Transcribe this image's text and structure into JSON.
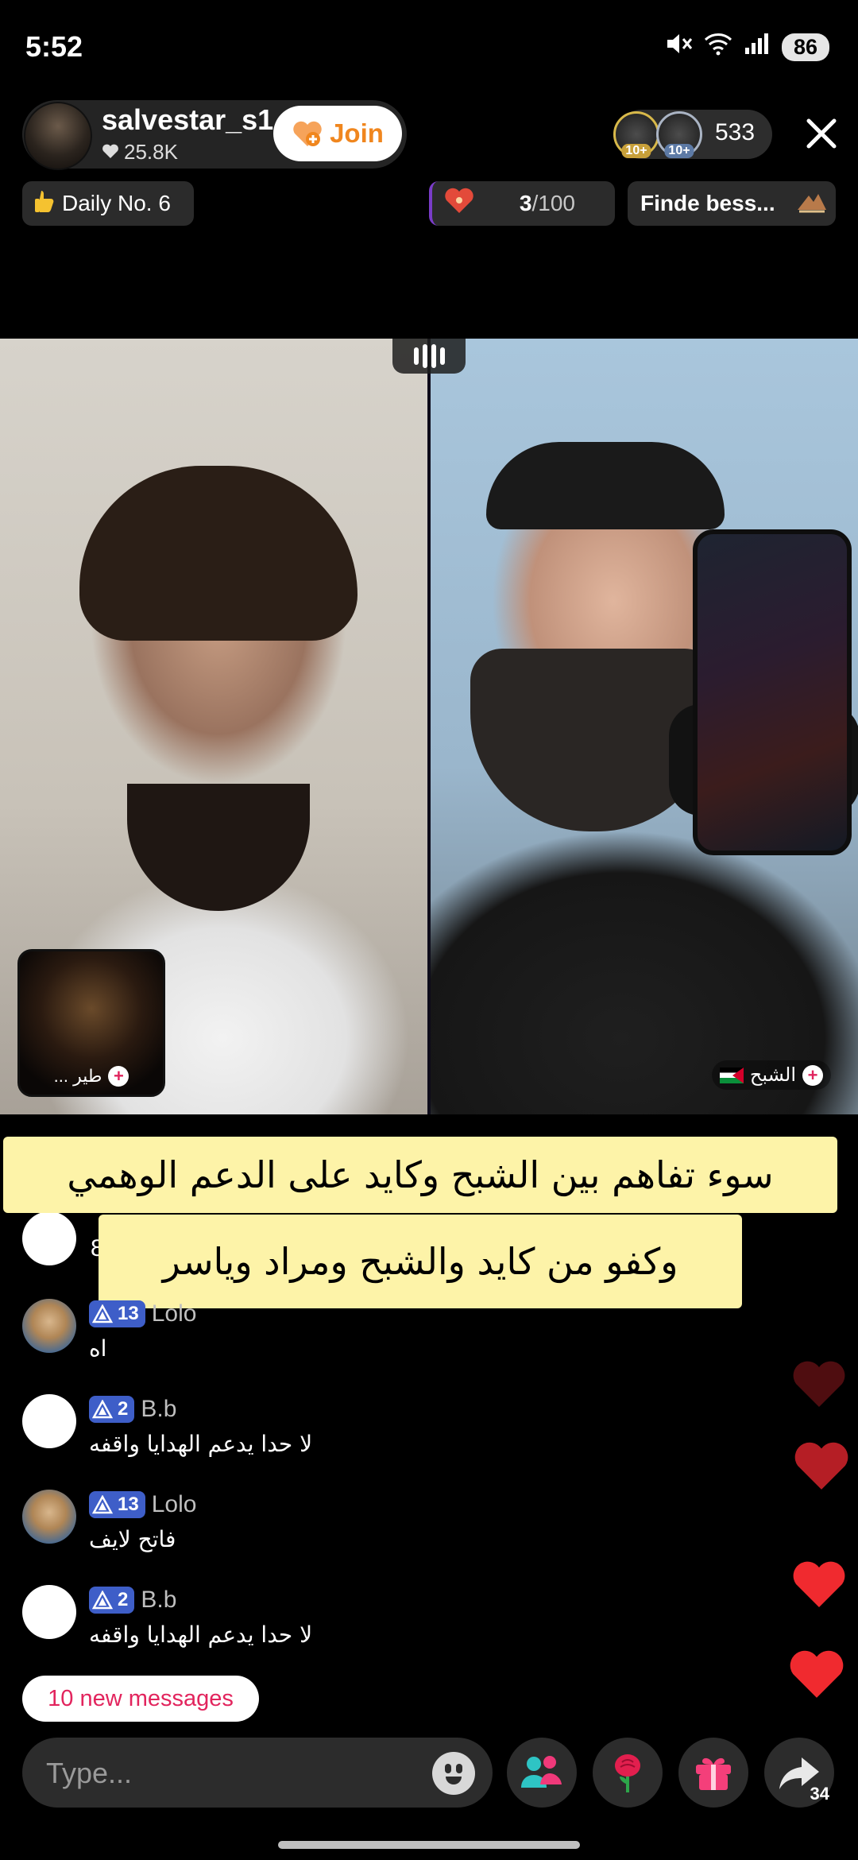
{
  "status_bar": {
    "time": "5:52",
    "battery": "86",
    "icons": [
      "mute-icon",
      "wifi-icon",
      "signal-icon",
      "battery-icon"
    ]
  },
  "host": {
    "username": "salvestar_s1",
    "likes": "25.8K",
    "join_label": "Join"
  },
  "viewers": {
    "badges": [
      "10+",
      "10+"
    ],
    "count": "533"
  },
  "chips": {
    "daily": "Daily No. 6",
    "goal_value": "3",
    "goal_total": "/100",
    "match": "Finde bess..."
  },
  "guests": {
    "small_box_name": "طير ...",
    "right_name": "الشبح"
  },
  "captions": {
    "line1": "سوء تفاهم بين الشبح وكايد على الدعم الوهمي",
    "line2": "وكفو من كايد والشبح ومراد وياسر"
  },
  "comments": {
    "partial_fragment": "8",
    "items": [
      {
        "level": "13",
        "name": "Lolo",
        "text": "اه",
        "avatar": "lolo"
      },
      {
        "level": "2",
        "name": "B.b",
        "text": "لا حدا يدعم الهدايا واقفه",
        "avatar": "blank"
      },
      {
        "level": "13",
        "name": "Lolo",
        "text": "فاتح لايف",
        "avatar": "lolo"
      },
      {
        "level": "2",
        "name": "B.b",
        "text": "لا حدا يدعم الهدايا واقفه",
        "avatar": "blank"
      }
    ]
  },
  "new_messages": "10 new messages",
  "composer": {
    "placeholder": "Type...",
    "share_count": "34"
  },
  "colors": {
    "accent_pink": "#e2245d",
    "join_orange": "#f0861e",
    "caption_bg": "#fdf3a8",
    "level_badge": "#3e5ec8",
    "heart_red": "#e3262f"
  }
}
